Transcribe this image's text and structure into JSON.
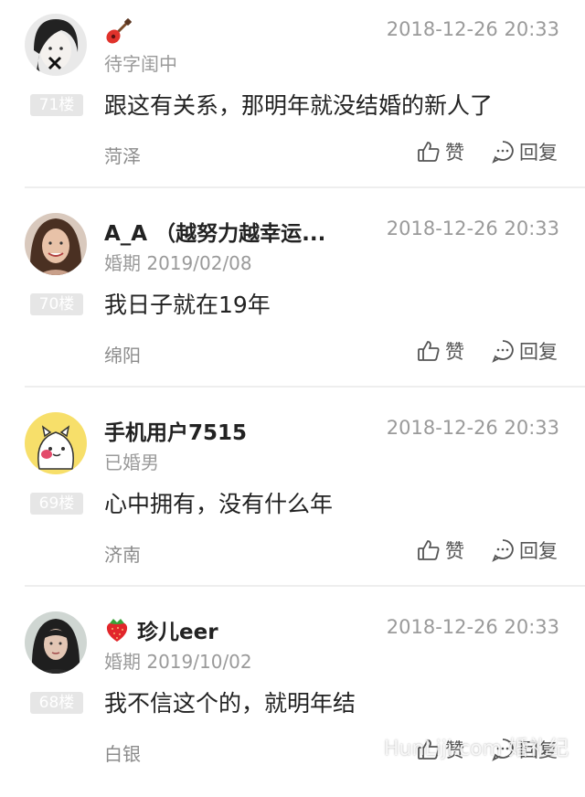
{
  "posts": [
    {
      "name": "",
      "name_emoji": "guitar-icon",
      "date": "2018-12-26 20:33",
      "status": "待字闺中",
      "floor": "71楼",
      "content": "跟这有关系，那明年就没结婚的新人了",
      "location": "菏泽",
      "like_label": "赞",
      "reply_label": "回复"
    },
    {
      "name": "A_A （越努力越幸运...",
      "date": "2018-12-26 20:33",
      "status": "婚期 2019/02/08",
      "floor": "70楼",
      "content": "我日子就在19年",
      "location": "绵阳",
      "like_label": "赞",
      "reply_label": "回复"
    },
    {
      "name": "手机用户7515",
      "date": "2018-12-26 20:33",
      "status": "已婚男",
      "floor": "69楼",
      "content": "心中拥有，没有什么年",
      "location": "济南",
      "like_label": "赞",
      "reply_label": "回复"
    },
    {
      "name": "珍儿eer",
      "name_emoji": "strawberry-icon",
      "date": "2018-12-26 20:33",
      "status": "婚期 2019/10/02",
      "floor": "68楼",
      "content": "我不信这个的，就明年结",
      "location": "白银",
      "like_label": "赞",
      "reply_label": "回复"
    }
  ],
  "watermark": "HunLiji.com 婚礼纪"
}
